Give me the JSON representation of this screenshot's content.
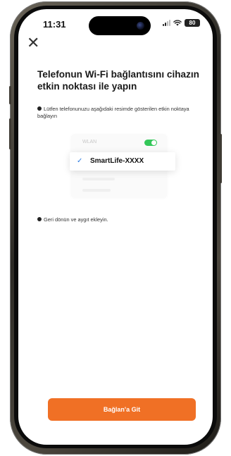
{
  "status_bar": {
    "time": "11:31",
    "battery": "80"
  },
  "header": {
    "title": "Telefonun Wi-Fi bağlantısını cihazın etkin noktası ile yapın"
  },
  "instructions": {
    "step1": "Lütfen telefonunuzu aşağıdaki resimde gösterilen etkin noktaya bağlayın",
    "step2": "Geri dönün ve aygıt ekleyin."
  },
  "wlan_illustration": {
    "label": "WLAN",
    "toggle_on": true,
    "network_name": "SmartLife-XXXX",
    "check_color": "#2a7ae2",
    "toggle_color": "#34c759"
  },
  "footer": {
    "button_label": "Bağlan'a Git",
    "button_color": "#f07025"
  },
  "icons": [
    "close-icon",
    "signal-icon",
    "wifi-icon",
    "battery-icon",
    "checkmark-icon",
    "toggle-switch"
  ]
}
